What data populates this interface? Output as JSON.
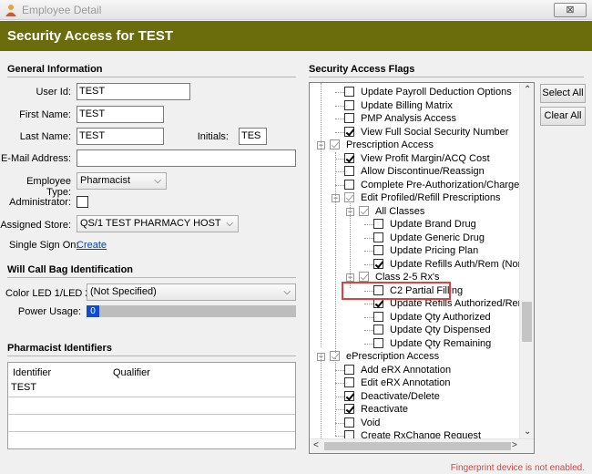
{
  "window": {
    "title": "Employee Detail",
    "close_label": "⊠"
  },
  "header": {
    "title": "Security Access for TEST"
  },
  "general": {
    "section_title": "General Information",
    "user_id_label": "User Id:",
    "user_id": "TEST",
    "first_name_label": "First Name:",
    "first_name": "TEST",
    "last_name_label": "Last Name:",
    "last_name": "TEST",
    "initials_label": "Initials:",
    "initials": "TES",
    "email_label": "E-Mail Address:",
    "email": "",
    "employee_type_label": "Employee Type:",
    "employee_type": "Pharmacist",
    "administrator_label": "Administrator:",
    "administrator_checked": false,
    "assigned_store_label": "Assigned Store:",
    "assigned_store": "QS/1 TEST PHARMACY HOST",
    "sso_label": "Single Sign On:",
    "sso_link": "Create"
  },
  "will_call": {
    "section_title": "Will Call Bag Identification",
    "led_label": "Color LED 1/LED 2:",
    "led_value": "(Not Specified)",
    "power_label": "Power Usage:",
    "power_value": "0"
  },
  "identifiers": {
    "section_title": "Pharmacist Identifiers",
    "columns": [
      "Identifier",
      "Qualifier"
    ],
    "rows": [
      [
        "TEST",
        ""
      ]
    ]
  },
  "flags": {
    "section_title": "Security Access Flags",
    "select_all": "Select All",
    "clear_all": "Clear All",
    "items": [
      {
        "label": "Update Payroll Deduction Options",
        "checked": false
      },
      {
        "label": "Update Billing Matrix",
        "checked": false
      },
      {
        "label": "PMP Analysis Access",
        "checked": false
      },
      {
        "label": "View Full Social Security Number",
        "checked": true
      },
      {
        "label": "Prescription Access",
        "checked": "partial"
      },
      {
        "label": "View Profit Margin/ACQ Cost",
        "checked": true
      },
      {
        "label": "Allow Discontinue/Reassign",
        "checked": false
      },
      {
        "label": "Complete Pre-Authorization/Charge Patie",
        "checked": false
      },
      {
        "label": "Edit Profiled/Refill Prescriptions",
        "checked": "partial"
      },
      {
        "label": "All Classes",
        "checked": "partial"
      },
      {
        "label": "Update Brand Drug",
        "checked": false
      },
      {
        "label": "Update Generic Drug",
        "checked": false
      },
      {
        "label": "Update Pricing Plan",
        "checked": false
      },
      {
        "label": "Update Refills Auth/Rem (Non-Cor",
        "checked": true
      },
      {
        "label": "Class 2-5 Rx's",
        "checked": "partial"
      },
      {
        "label": "C2 Partial Filling",
        "checked": false
      },
      {
        "label": "Update Refills Authorized/Remaini",
        "checked": true
      },
      {
        "label": "Update Qty Authorized",
        "checked": false
      },
      {
        "label": "Update Qty Dispensed",
        "checked": false
      },
      {
        "label": "Update Qty Remaining",
        "checked": false
      },
      {
        "label": "ePrescription Access",
        "checked": "partial"
      },
      {
        "label": "Add eRX Annotation",
        "checked": false
      },
      {
        "label": "Edit eRX Annotation",
        "checked": false
      },
      {
        "label": "Deactivate/Delete",
        "checked": true
      },
      {
        "label": "Reactivate",
        "checked": true
      },
      {
        "label": "Void",
        "checked": false
      },
      {
        "label": "Create RxChange Request",
        "checked": false
      }
    ]
  },
  "status": {
    "message": "Fingerprint device is not enabled."
  },
  "colors": {
    "header_bg": "#6b6c0c",
    "highlight": "#e0403f",
    "link": "#0645ad",
    "power_fill": "#0b4bd6"
  }
}
